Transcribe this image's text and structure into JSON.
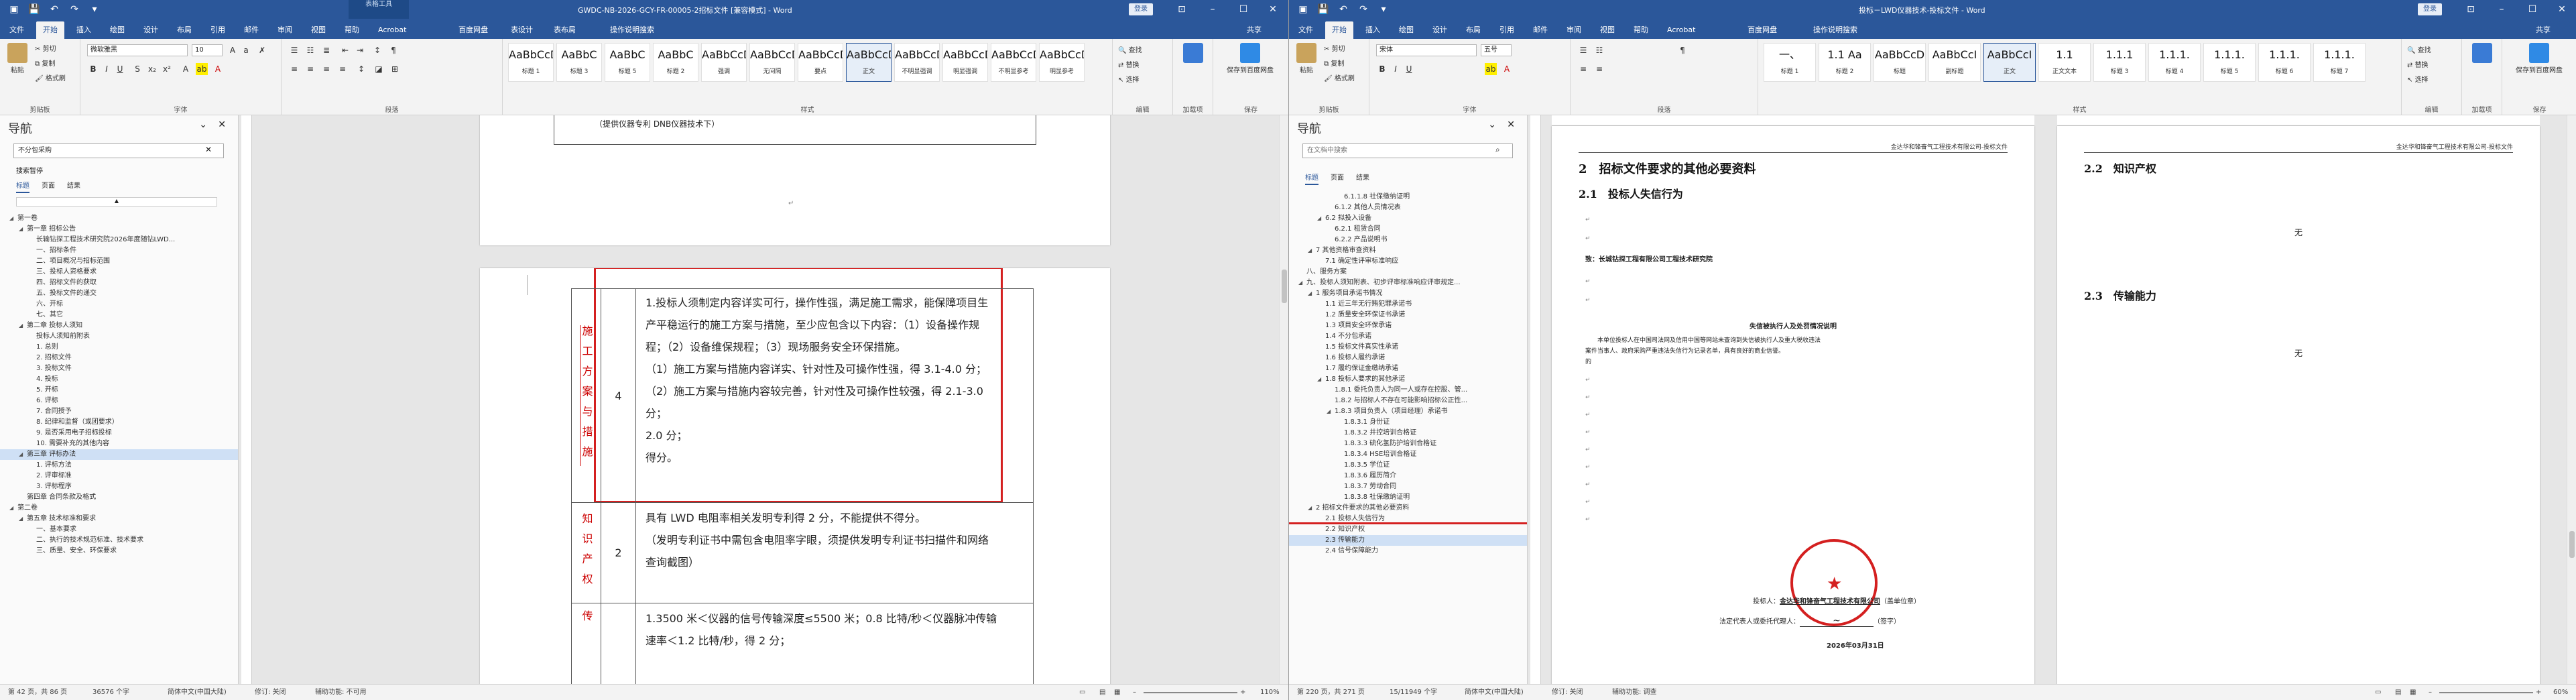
{
  "colors": {
    "brand": "#2b579a",
    "red": "#d42020",
    "highlight_row": "#cfe0f5"
  },
  "w1": {
    "title": "GWDC-NB-2026-GCY-FR-00005-2招标文件 [兼容模式] - Word",
    "ctx": "表格工具",
    "user": "登录",
    "tabs": [
      "文件",
      "开始",
      "插入",
      "绘图",
      "设计",
      "布局",
      "引用",
      "邮件",
      "审阅",
      "视图",
      "帮助",
      "Acrobat",
      "百度网盘",
      "表设计",
      "表布局"
    ],
    "tellme": "操作说明搜索",
    "share": "共享",
    "clip": {
      "paste": "粘贴",
      "cut": "剪切",
      "copy": "复制",
      "fmt": "格式刷",
      "label": "剪贴板"
    },
    "font": {
      "name": "微软雅黑",
      "size": "10",
      "label": "字体"
    },
    "para_label": "段落",
    "styles": [
      {
        "pv": "AaBbCcDd",
        "nm": "标题 1"
      },
      {
        "pv": "AaBbC",
        "nm": "标题 3"
      },
      {
        "pv": "AaBbC",
        "nm": "标题 5"
      },
      {
        "pv": "AaBbC",
        "nm": "标题 2"
      },
      {
        "pv": "AaBbCcDd",
        "nm": "强调"
      },
      {
        "pv": "AaBbCcDd",
        "nm": "无间隔"
      },
      {
        "pv": "AaBbCcDd",
        "nm": "要点"
      },
      {
        "pv": "AaBbCcDd",
        "nm": "正文"
      },
      {
        "pv": "AaBbCcDd",
        "nm": "不明显强调"
      },
      {
        "pv": "AaBbCcDd",
        "nm": "明显强调"
      },
      {
        "pv": "AaBbCcDd",
        "nm": "不明显参考"
      },
      {
        "pv": "AaBbCcDd",
        "nm": "明显参考"
      }
    ],
    "styles_label": "样式",
    "edit": {
      "find": "查找",
      "replace": "替换",
      "select": "选择",
      "label": "编辑"
    },
    "addin": "加载项",
    "save_baidu": "保存到百度网盘",
    "save_label": "保存",
    "nav": {
      "title": "导航",
      "search": "不分包采购",
      "search_hint": "搜索暂停",
      "tabs": [
        "标题",
        "页面",
        "结果"
      ],
      "items": [
        {
          "t": "第一卷",
          "l": 0,
          "tw": "◢"
        },
        {
          "t": "第一章 招标公告",
          "l": 1,
          "tw": "◢"
        },
        {
          "t": "长输钻探工程技术研究院2026年度随钻LWD...",
          "l": 2,
          "tw": ""
        },
        {
          "t": "一、招标条件",
          "l": 2,
          "tw": ""
        },
        {
          "t": "二、项目概况与招标范围",
          "l": 2,
          "tw": ""
        },
        {
          "t": "三、投标人资格要求",
          "l": 2,
          "tw": ""
        },
        {
          "t": "四、招标文件的获取",
          "l": 2,
          "tw": ""
        },
        {
          "t": "五、投标文件的递交",
          "l": 2,
          "tw": ""
        },
        {
          "t": "六、开标",
          "l": 2,
          "tw": ""
        },
        {
          "t": "七、其它",
          "l": 2,
          "tw": ""
        },
        {
          "t": "第二章 投标人须知",
          "l": 1,
          "tw": "◢"
        },
        {
          "t": "投标人须知前附表",
          "l": 2,
          "tw": ""
        },
        {
          "t": "1. 总则",
          "l": 2,
          "tw": ""
        },
        {
          "t": "2. 招标文件",
          "l": 2,
          "tw": ""
        },
        {
          "t": "3. 投标文件",
          "l": 2,
          "tw": ""
        },
        {
          "t": "4. 投标",
          "l": 2,
          "tw": ""
        },
        {
          "t": "5. 开标",
          "l": 2,
          "tw": ""
        },
        {
          "t": "6. 评标",
          "l": 2,
          "tw": ""
        },
        {
          "t": "7. 合同授予",
          "l": 2,
          "tw": ""
        },
        {
          "t": "8. 纪律和监督（或团要求）",
          "l": 2,
          "tw": ""
        },
        {
          "t": "9. 是否采用电子招标投标",
          "l": 2,
          "tw": ""
        },
        {
          "t": "10. 需要补充的其他内容",
          "l": 2,
          "tw": ""
        },
        {
          "t": "第三章 评标办法",
          "l": 1,
          "tw": "◢",
          "sel": true
        },
        {
          "t": "1. 评标方法",
          "l": 2,
          "tw": ""
        },
        {
          "t": "2. 评审标准",
          "l": 2,
          "tw": ""
        },
        {
          "t": "3. 评标程序",
          "l": 2,
          "tw": ""
        },
        {
          "t": "第四章 合同条款及格式",
          "l": 1,
          "tw": ""
        },
        {
          "t": "第二卷",
          "l": 0,
          "tw": "◢"
        },
        {
          "t": "第五章 技术标准和要求",
          "l": 1,
          "tw": "◢"
        },
        {
          "t": "一、基本要求",
          "l": 2,
          "tw": ""
        },
        {
          "t": "二、执行的技术规范标准、技术要求",
          "l": 2,
          "tw": ""
        },
        {
          "t": "三、质量、安全、环保要求",
          "l": 2,
          "tw": ""
        }
      ]
    },
    "doc": {
      "top_line": "（提供仪器专利 DNB仪器技术下）",
      "col1": "施工方案与措施",
      "score1": "4",
      "lines": [
        "1.投标人须制定内容详实可行，操作性强，满足施工需求，能保障项目生",
        "产平稳运行的施工方案与措施，至少应包含以下内容：（1）设备操作规",
        "程；（2）设备维保规程；（3）现场服务安全环保措施。",
        "（1）施工方案与措施内容详实、针对性及可操作性强，得 3.1-4.0 分；",
        "（2）施工方案与措施内容较完善，针对性及可操作性较强，得 2.1-3.0",
        "分；",
        "2.0 分；",
        "得分。"
      ],
      "col2": "知识产权",
      "score2": "2",
      "lines2": [
        "具有 LWD 电阻率相关发明专利得 2 分，不能提供不得分。",
        "（发明专利证书中需包含电阻率字眼，须提供发明专利证书扫描件和网络",
        "查询截图）"
      ],
      "col3": "传",
      "lines3": [
        "1.3500 米＜仪器的信号传输深度≤5500 米；0.8 比特/秒＜仪器脉冲传输",
        "速率＜1.2 比特/秒，得 2 分；"
      ]
    },
    "status": {
      "page": "第 42 页，共 86 页",
      "words": "36576 个字",
      "lang": "简体中文(中国大陆)",
      "track": "修订: 关闭",
      "access": "辅助功能: 不可用",
      "zoom": "110%"
    }
  },
  "w2": {
    "title": "投标－LWD仪器技术-投标文件 - Word",
    "user": "登录",
    "tabs": [
      "文件",
      "开始",
      "插入",
      "绘图",
      "设计",
      "布局",
      "引用",
      "邮件",
      "审阅",
      "视图",
      "帮助",
      "Acrobat",
      "百度网盘"
    ],
    "tellme": "操作说明搜索",
    "share": "共享",
    "font": {
      "name": "宋体",
      "size": "五号"
    },
    "styles": [
      {
        "pv": "一、",
        "nm": "标题 1"
      },
      {
        "pv": "1.1 Aa",
        "nm": "标题 2"
      },
      {
        "pv": "AaBbCcD",
        "nm": "标题"
      },
      {
        "pv": "AaBbCcI",
        "nm": "副标题"
      },
      {
        "pv": "AaBbCcI",
        "nm": "正文"
      },
      {
        "pv": "1.1",
        "nm": "正文文本"
      },
      {
        "pv": "1.1.1",
        "nm": "标题 3"
      },
      {
        "pv": "1.1.1.",
        "nm": "标题 4"
      },
      {
        "pv": "1.1.1.",
        "nm": "标题 5"
      },
      {
        "pv": "1.1.1.",
        "nm": "标题 6"
      },
      {
        "pv": "1.1.1.",
        "nm": "标题 7"
      }
    ],
    "nav": {
      "title": "导航",
      "search": "在文档中搜索",
      "tabs": [
        "标题",
        "页面",
        "结果"
      ],
      "items": [
        {
          "t": "6.1.1.8 社保缴纳证明",
          "l": 4
        },
        {
          "t": "6.1.2 其他人员情况表",
          "l": 3
        },
        {
          "t": "6.2 拟投入设备",
          "l": 2,
          "tw": "◢"
        },
        {
          "t": "6.2.1 租赁合同",
          "l": 3
        },
        {
          "t": "6.2.2 产品说明书",
          "l": 3
        },
        {
          "t": "7 其他资格审查资料",
          "l": 1,
          "tw": "◢"
        },
        {
          "t": "7.1 确定性评审标准响应",
          "l": 2
        },
        {
          "t": "八、服务方案",
          "l": 0
        },
        {
          "t": "九、投标人须知附表、初步评审标准响应评审规定...",
          "l": 0,
          "tw": "◢"
        },
        {
          "t": "1 服务项目承诺书情况",
          "l": 1,
          "tw": "◢"
        },
        {
          "t": "1.1 近三年无行贿犯罪承诺书",
          "l": 2
        },
        {
          "t": "1.2 质量安全环保证书承诺",
          "l": 2
        },
        {
          "t": "1.3 项目安全环保承诺",
          "l": 2
        },
        {
          "t": "1.4 不分包承诺",
          "l": 2
        },
        {
          "t": "1.5 投标文件真实性承诺",
          "l": 2
        },
        {
          "t": "1.6 投标人履约承诺",
          "l": 2
        },
        {
          "t": "1.7 履约保证金缴纳承诺",
          "l": 2
        },
        {
          "t": "1.8 投标人要求的其他承诺",
          "l": 2,
          "tw": "◢"
        },
        {
          "t": "1.8.1 委托负责人为同一人或存在控股、管...",
          "l": 3
        },
        {
          "t": "1.8.2 与招标人不存在可能影响招标公正性...",
          "l": 3
        },
        {
          "t": "1.8.3 项目负责人（项目经理）承诺书",
          "l": 3,
          "tw": "◢"
        },
        {
          "t": "1.8.3.1 身份证",
          "l": 4
        },
        {
          "t": "1.8.3.2 井控培训合格证",
          "l": 4
        },
        {
          "t": "1.8.3.3 硫化氢防护培训合格证",
          "l": 4
        },
        {
          "t": "1.8.3.4 HSE培训合格证",
          "l": 4
        },
        {
          "t": "1.8.3.5 学位证",
          "l": 4
        },
        {
          "t": "1.8.3.6 履历简介",
          "l": 4
        },
        {
          "t": "1.8.3.7 劳动合同",
          "l": 4
        },
        {
          "t": "1.8.3.8 社保缴纳证明",
          "l": 4
        },
        {
          "t": "2 招标文件要求的其他必要资料",
          "l": 1,
          "tw": "◢"
        },
        {
          "t": "2.1 投标人失信行为",
          "l": 2,
          "red": true
        },
        {
          "t": "2.2 知识产权",
          "l": 2
        },
        {
          "t": "2.3 传输能力",
          "l": 2,
          "sel": true
        },
        {
          "t": "2.4 信号保障能力",
          "l": 2
        }
      ]
    },
    "page1": {
      "header": "金达华和锋奋气工程技术有限公司-投标文件",
      "h2": "2　招标文件要求的其他必要资料",
      "h21": "2.1　投标人失信行为",
      "to": "致：长城钻探工程有限公司工程技术研究院",
      "sub": "失信被执行人及处罚情况说明",
      "para1": "　　本单位投标人在中国司法网及信用中国等网站未查询到失信被执行人及重大税收违法",
      "para2": "案件当事人、政府采购严重违法失信行为记录名单，具有良好的商业信誉。",
      "para3": "的",
      "sign1": "投标人：",
      "company": "金达华和锋奋气工程技术有限公司",
      "seal_note": "（盖单位章）",
      "sign2": "法定代表人或委托代理人：",
      "sign_note": "（签字）",
      "date": "2026年03月31日"
    },
    "page2": {
      "header": "金达华和锋奋气工程技术有限公司-投标文件",
      "h22": "2.2　知识产权",
      "none1": "无",
      "h23": "2.3　传输能力",
      "none2": "无"
    },
    "status": {
      "page": "第 220 页，共 271 页",
      "words": "15/11949 个字",
      "lang": "简体中文(中国大陆)",
      "track": "修订: 关闭",
      "access": "辅助功能: 调查",
      "zoom": "60%"
    }
  }
}
